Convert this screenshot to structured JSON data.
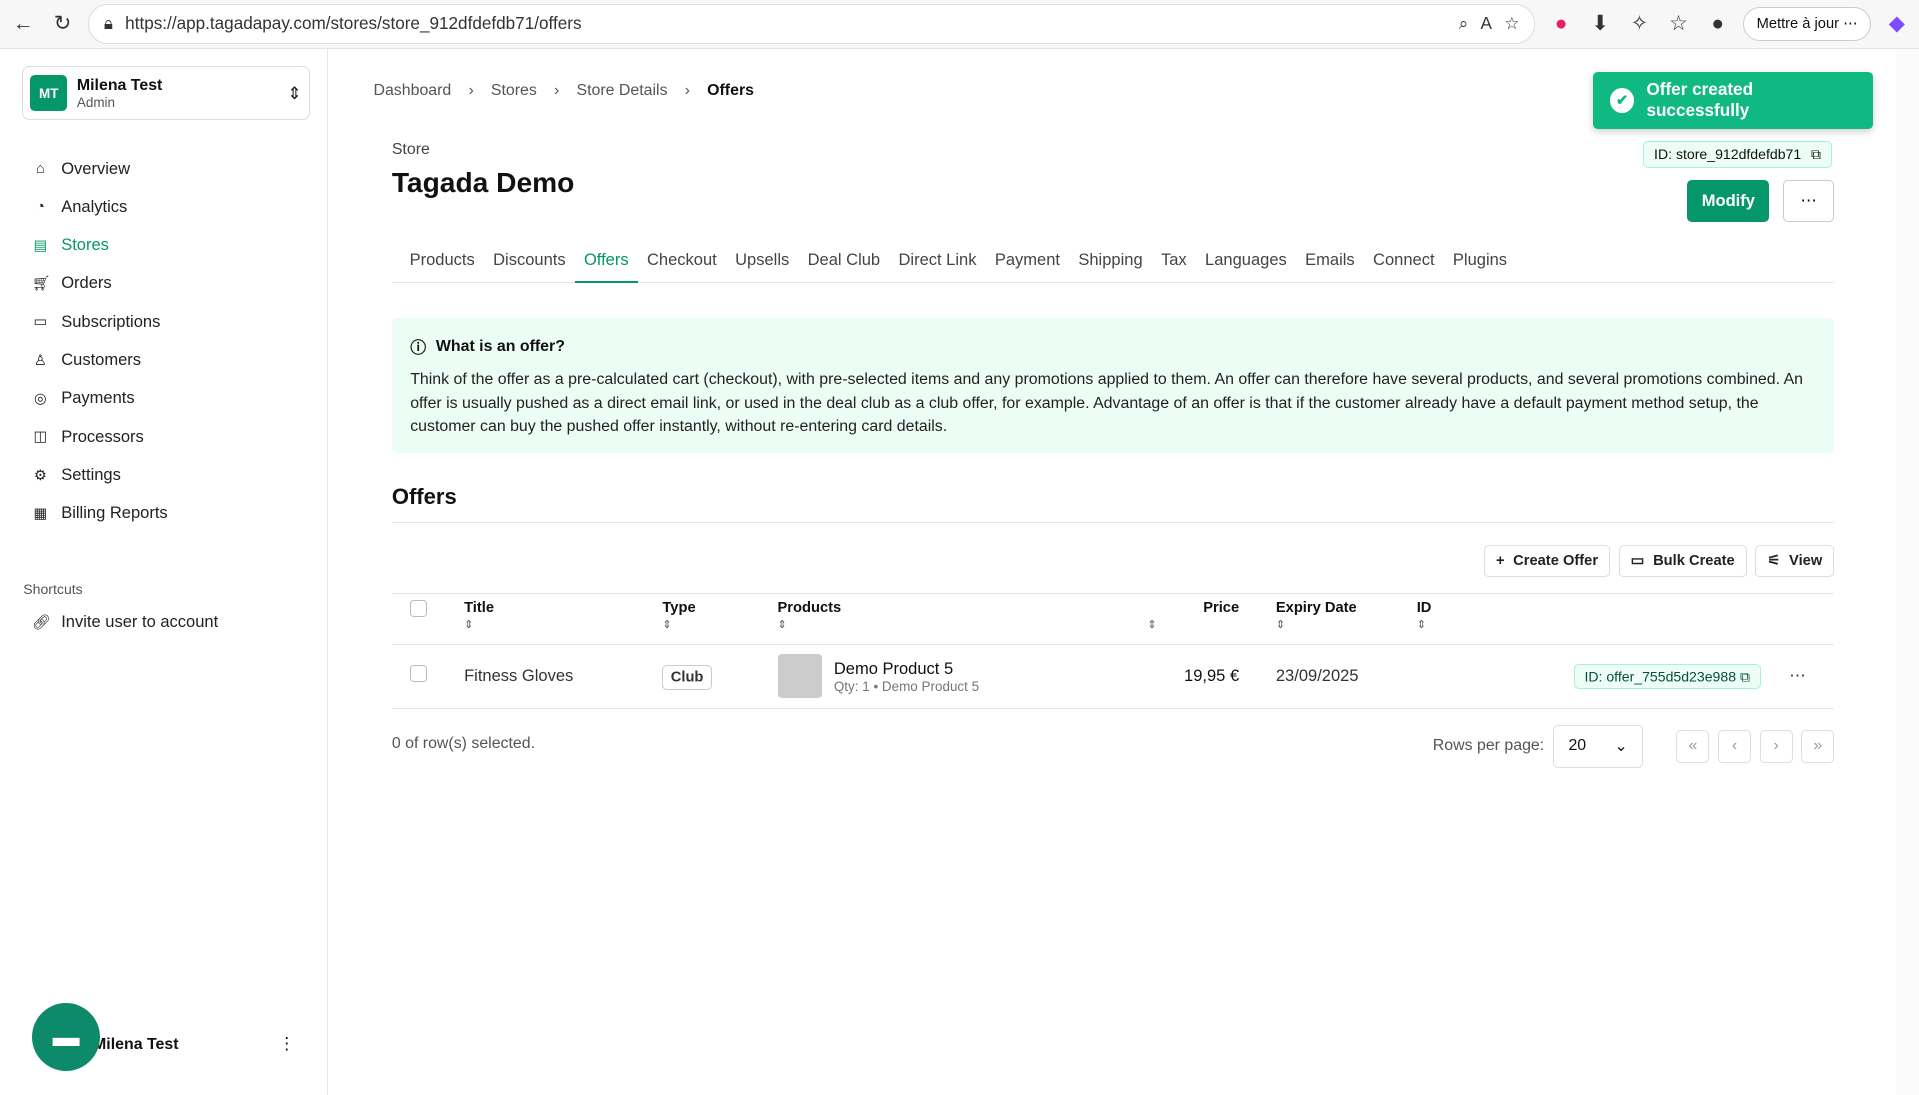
{
  "browser": {
    "url": "https://app.tagadapay.com/stores/store_912dfdefdb71/offers",
    "update_label": "Mettre à jour"
  },
  "sidebar": {
    "account": {
      "initials": "MT",
      "name": "Milena Test",
      "role": "Admin"
    },
    "items": [
      {
        "label": "Overview",
        "icon": "home-icon"
      },
      {
        "label": "Analytics",
        "icon": "chart-pie-icon"
      },
      {
        "label": "Stores",
        "icon": "store-icon"
      },
      {
        "label": "Orders",
        "icon": "cart-icon"
      },
      {
        "label": "Subscriptions",
        "icon": "subscription-icon"
      },
      {
        "label": "Customers",
        "icon": "user-icon"
      },
      {
        "label": "Payments",
        "icon": "coin-icon"
      },
      {
        "label": "Processors",
        "icon": "processor-icon"
      },
      {
        "label": "Settings",
        "icon": "gear-icon"
      },
      {
        "label": "Billing Reports",
        "icon": "report-icon"
      }
    ],
    "shortcuts_label": "Shortcuts",
    "shortcut": "Invite user to account",
    "footer_name": "Milena Test"
  },
  "breadcrumb": [
    "Dashboard",
    "Stores",
    "Store Details",
    "Offers"
  ],
  "toast": "Offer created successfully",
  "store": {
    "label": "Store",
    "title": "Tagada Demo",
    "id": "ID: store_912dfdefdb71",
    "modify": "Modify"
  },
  "tabs": [
    "Products",
    "Discounts",
    "Offers",
    "Checkout",
    "Upsells",
    "Deal Club",
    "Direct Link",
    "Payment",
    "Shipping",
    "Tax",
    "Languages",
    "Emails",
    "Connect",
    "Plugins"
  ],
  "info": {
    "title": "What is an offer?",
    "text": "Think of the offer as a pre-calculated cart (checkout), with pre-selected items and any promotions applied to them. An offer can therefore have several products, and several promotions combined. An offer is usually pushed as a direct email link, or used in the deal club as a club offer, for example. Advantage of an offer is that if the customer already have a default payment method setup, the customer can buy the pushed offer instantly, without re-entering card details."
  },
  "offers": {
    "heading": "Offers",
    "create": "Create Offer",
    "bulk": "Bulk Create",
    "view": "View",
    "columns": [
      "Title",
      "Type",
      "Products",
      "Price",
      "Expiry Date",
      "ID"
    ],
    "rows": [
      {
        "title": "Fitness Gloves",
        "type": "Club",
        "product": "Demo Product 5",
        "qty": "Qty: 1",
        "sub": "Demo Product 5",
        "price": "19,95 €",
        "expiry": "23/09/2025",
        "id": "ID: offer_755d5d23e988"
      }
    ],
    "selected": "0 of row(s) selected.",
    "rows_per_page": "Rows per page:",
    "page_size": "20"
  }
}
